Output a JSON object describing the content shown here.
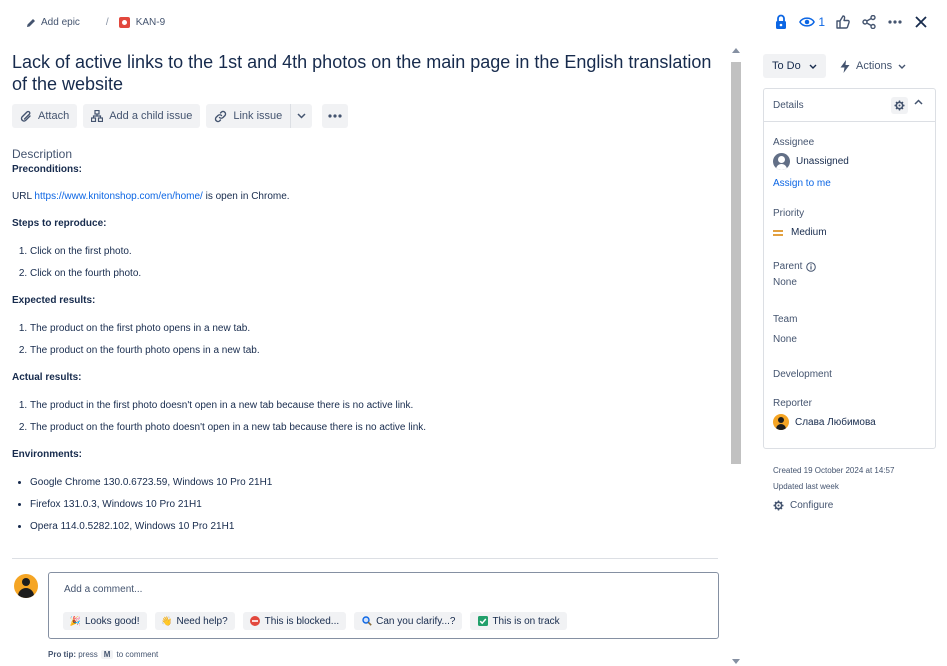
{
  "breadcrumb": {
    "add_epic": "Add epic",
    "separator": "/",
    "issue_key": "KAN-9"
  },
  "header": {
    "watch_count": "1"
  },
  "issue": {
    "title": "Lack of active links to the 1st and 4th photos on the main page in the English translation of the website"
  },
  "toolbar": {
    "attach": "Attach",
    "add_child": "Add a child issue",
    "link_issue": "Link issue"
  },
  "description": {
    "label": "Description",
    "preconditions_h": "Preconditions:",
    "url_prefix": "URL",
    "url": "https://www.knitonshop.com/en/home/",
    "url_suffix": " is open in Chrome.",
    "steps_h": "Steps to reproduce:",
    "steps": [
      "Click on the first photo.",
      "Click on the fourth photo."
    ],
    "expected_h": "Expected results:",
    "expected": [
      "The product on the first photo opens in a new tab.",
      "The product on the fourth photo opens in a new tab."
    ],
    "actual_h": "Actual results:",
    "actual": [
      "The product in the first photo doesn't open in a new tab because there is no active link.",
      "The product on the fourth photo doesn't open in a new tab because there is no active link."
    ],
    "env_h": "Environments:",
    "environments": [
      "Google Chrome 130.0.6723.59, Windows 10 Pro 21H1",
      "Firefox 131.0.3, Windows 10 Pro 21H1",
      "Opera 114.0.5282.102, Windows 10 Pro 21H1"
    ]
  },
  "comment": {
    "placeholder": "Add a comment...",
    "chips": [
      "Looks good!",
      "Need help?",
      "This is blocked...",
      "Can you clarify...?",
      "This is on track"
    ],
    "protip_label": "Pro tip:",
    "protip_press": "press",
    "protip_key": "M",
    "protip_suffix": "to comment"
  },
  "sidebar": {
    "status": "To Do",
    "actions": "Actions",
    "details_title": "Details",
    "assignee_label": "Assignee",
    "assignee_value": "Unassigned",
    "assign_to_me": "Assign to me",
    "priority_label": "Priority",
    "priority_value": "Medium",
    "parent_label": "Parent",
    "parent_value": "None",
    "team_label": "Team",
    "team_value": "None",
    "development_label": "Development",
    "reporter_label": "Reporter",
    "reporter_value": "Слава Любимова",
    "created": "Created 19 October 2024 at 14:57",
    "updated": "Updated last week",
    "configure": "Configure"
  },
  "colors": {
    "accent": "#0c66e4",
    "bug": "#e2483d",
    "priority_medium": "#e2a03f"
  }
}
